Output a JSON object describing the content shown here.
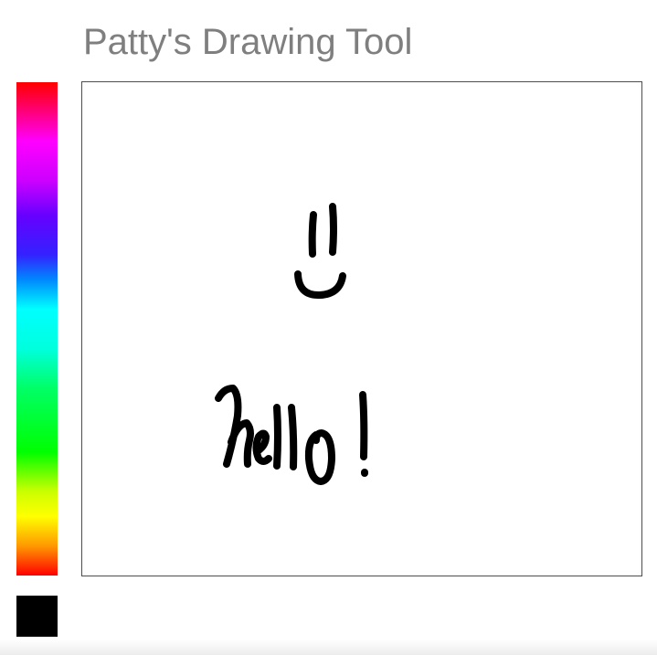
{
  "app": {
    "title": "Patty's Drawing Tool"
  },
  "palette": {
    "icon": "color-spectrum"
  },
  "current_color": {
    "hex": "#000000"
  },
  "canvas": {
    "background": "#ffffff",
    "border_color": "#4d4d4d",
    "stroke_color": "#000000"
  }
}
